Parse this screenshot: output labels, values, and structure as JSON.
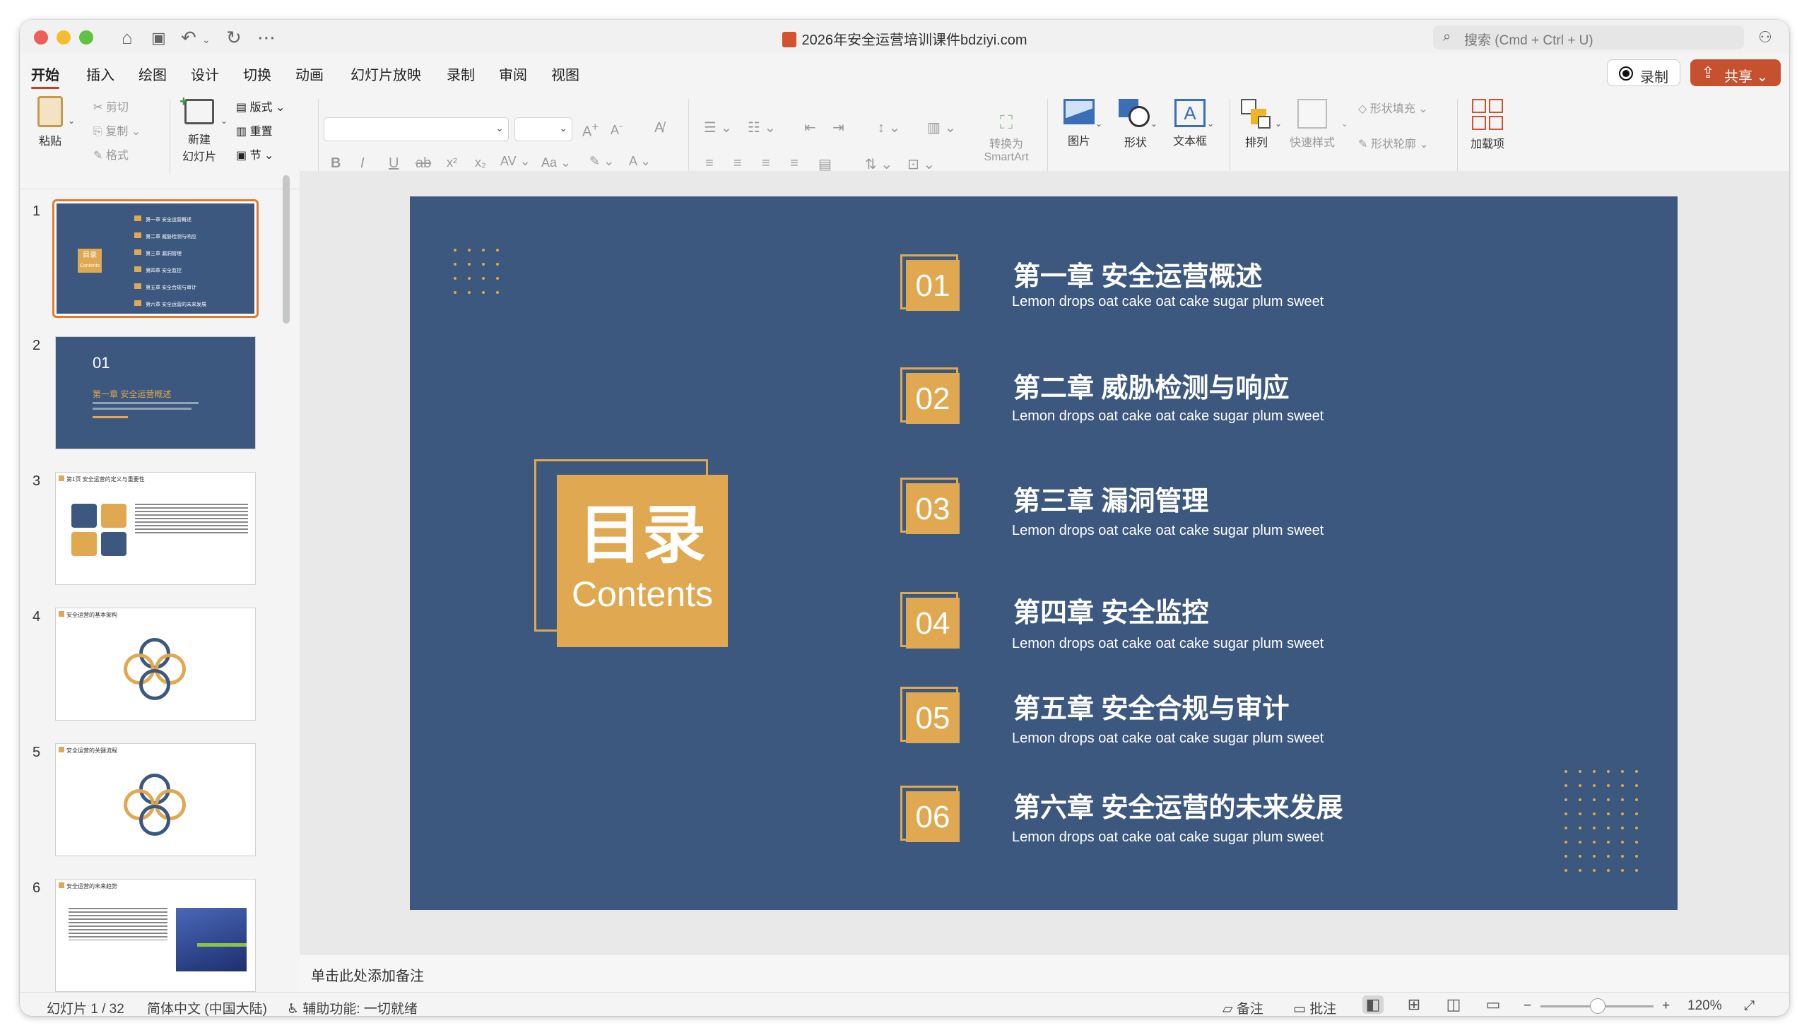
{
  "window": {
    "title": "2026年安全运营培训课件bdziyi.com",
    "search_placeholder": "搜索 (Cmd + Ctrl + U)"
  },
  "tabs": [
    "开始",
    "插入",
    "绘图",
    "设计",
    "切换",
    "动画",
    "幻灯片放映",
    "录制",
    "审阅",
    "视图"
  ],
  "header_buttons": {
    "record": "录制",
    "share": "共享"
  },
  "ribbon": {
    "paste": "粘贴",
    "cut": "剪切",
    "copy": "复制",
    "format": "格式",
    "new_slide_line1": "新建",
    "new_slide_line2": "幻灯片",
    "layout": "版式",
    "reset": "重置",
    "section": "节",
    "convert_smartart_line1": "转换为",
    "convert_smartart_line2": "SmartArt",
    "picture": "图片",
    "shape": "形状",
    "textbox": "文本框",
    "arrange": "排列",
    "quick_styles": "快速样式",
    "shape_fill": "形状填充",
    "shape_outline": "形状轮廓",
    "addins": "加载项"
  },
  "thumbnails": [
    {
      "num": "1",
      "items": [
        "第一章 安全运营概述",
        "第二章 威胁检测与响应",
        "第三章 漏洞管理",
        "第四章 安全监控",
        "第五章 安全合规与审计",
        "第六章 安全运营的未来发展"
      ],
      "box_title": "目录",
      "box_sub": "Contents"
    },
    {
      "num": "2",
      "chapter_num": "01",
      "chapter_title": "第一章 安全运营概述"
    },
    {
      "num": "3",
      "title": "第1页 安全运营的定义与重要性"
    },
    {
      "num": "4",
      "title": "安全运营的基本架构"
    },
    {
      "num": "5",
      "title": "安全运营的关键流程"
    },
    {
      "num": "6",
      "title": "安全运营的未来趋势"
    }
  ],
  "slide": {
    "box_title": "目录",
    "box_subtitle": "Contents",
    "chapters": [
      {
        "num": "01",
        "title": "第一章 安全运营概述",
        "subtitle": "Lemon drops oat cake oat cake sugar plum sweet"
      },
      {
        "num": "02",
        "title": "第二章 威胁检测与响应",
        "subtitle": "Lemon drops oat cake oat cake sugar plum sweet"
      },
      {
        "num": "03",
        "title": "第三章 漏洞管理",
        "subtitle": "Lemon drops oat cake oat cake sugar plum sweet"
      },
      {
        "num": "04",
        "title": "第四章 安全监控",
        "subtitle": "Lemon drops oat cake oat cake sugar plum sweet"
      },
      {
        "num": "05",
        "title": "第五章 安全合规与审计",
        "subtitle": "Lemon drops oat cake oat cake sugar plum sweet"
      },
      {
        "num": "06",
        "title": "第六章 安全运营的未来发展",
        "subtitle": "Lemon drops oat cake oat cake sugar plum sweet"
      }
    ],
    "colors": {
      "background": "#3c587f",
      "accent": "#e0a850"
    }
  },
  "notes_placeholder": "单击此处添加备注",
  "status": {
    "slide_counter": "幻灯片 1 / 32",
    "language": "简体中文 (中国大陆)",
    "accessibility": "辅助功能: 一切就绪",
    "notes": "备注",
    "comments": "批注",
    "zoom": "120%"
  }
}
